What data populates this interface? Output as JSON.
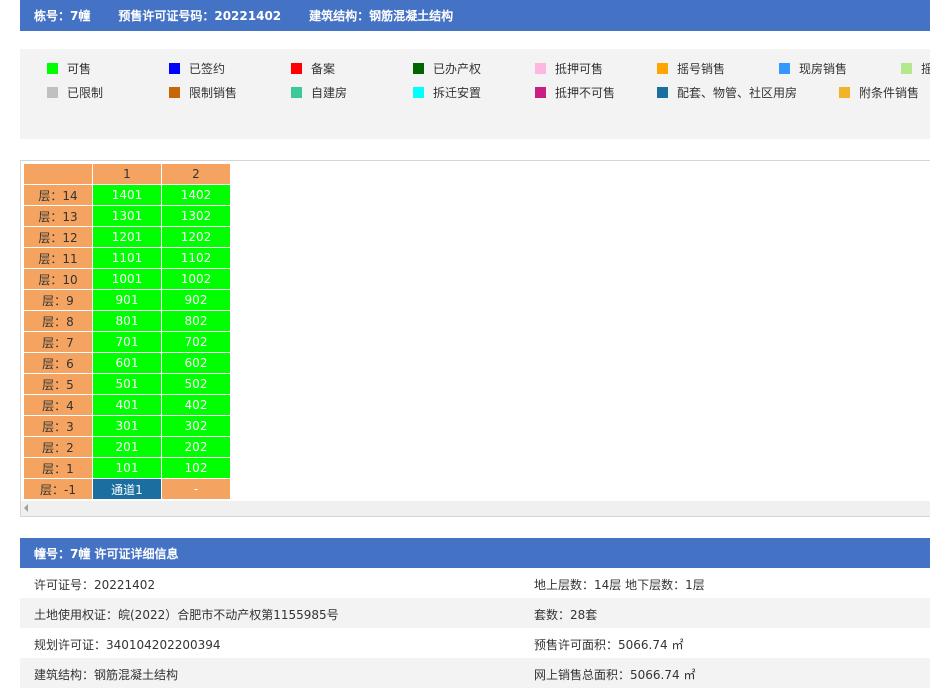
{
  "header": {
    "building": "栋号：7幢",
    "permit": "预售许可证号码：20221402",
    "structure": "建筑结构：钢筋混凝土结构"
  },
  "legend": [
    {
      "label": "可售",
      "color": "#00ff00"
    },
    {
      "label": "已签约",
      "color": "#0000ff"
    },
    {
      "label": "备案",
      "color": "#ff0000"
    },
    {
      "label": "已办产权",
      "color": "#006400"
    },
    {
      "label": "抵押可售",
      "color": "#ffb6e1"
    },
    {
      "label": "摇号销售",
      "color": "#ffa500"
    },
    {
      "label": "现房销售",
      "color": "#3399ff"
    },
    {
      "label": "摇",
      "color": "#b4e88c"
    },
    {
      "label": "已限制",
      "color": "#c0c0c0"
    },
    {
      "label": "限制销售",
      "color": "#c8660a"
    },
    {
      "label": "自建房",
      "color": "#3cc99a"
    },
    {
      "label": "拆迁安置",
      "color": "#00ffff"
    },
    {
      "label": "抵押不可售",
      "color": "#c71f83"
    },
    {
      "label": "配套、物管、社区用房",
      "color": "#1a6fa0"
    },
    {
      "label": "附条件销售",
      "color": "#f0b428"
    }
  ],
  "grid": {
    "columns": [
      "1",
      "2"
    ],
    "rows": [
      {
        "floor": "层：14",
        "units": [
          "1401",
          "1402"
        ]
      },
      {
        "floor": "层：13",
        "units": [
          "1301",
          "1302"
        ]
      },
      {
        "floor": "层：12",
        "units": [
          "1201",
          "1202"
        ]
      },
      {
        "floor": "层：11",
        "units": [
          "1101",
          "1102"
        ]
      },
      {
        "floor": "层：10",
        "units": [
          "1001",
          "1002"
        ]
      },
      {
        "floor": "层：9",
        "units": [
          "901",
          "902"
        ]
      },
      {
        "floor": "层：8",
        "units": [
          "801",
          "802"
        ]
      },
      {
        "floor": "层：7",
        "units": [
          "701",
          "702"
        ]
      },
      {
        "floor": "层：6",
        "units": [
          "601",
          "602"
        ]
      },
      {
        "floor": "层：5",
        "units": [
          "501",
          "502"
        ]
      },
      {
        "floor": "层：4",
        "units": [
          "401",
          "402"
        ]
      },
      {
        "floor": "层：3",
        "units": [
          "301",
          "302"
        ]
      },
      {
        "floor": "层：2",
        "units": [
          "201",
          "202"
        ]
      },
      {
        "floor": "层：1",
        "units": [
          "101",
          "102"
        ]
      }
    ],
    "basement": {
      "floor": "层：-1",
      "units": [
        "通道1",
        "-"
      ]
    }
  },
  "detail": {
    "title": "幢号：7幢 许可证详细信息",
    "rows": [
      {
        "left": "许可证号：20221402",
        "right": "地上层数：14层  地下层数：1层"
      },
      {
        "left": "土地使用权证：皖(2022）合肥市不动产权第1155985号",
        "right": "套数：28套"
      },
      {
        "left": "规划许可证：340104202200394",
        "right": "预售许可面积：5066.74 ㎡"
      },
      {
        "left": "建筑结构：钢筋混凝土结构",
        "right": "网上销售总面积：5066.74 ㎡"
      }
    ]
  }
}
